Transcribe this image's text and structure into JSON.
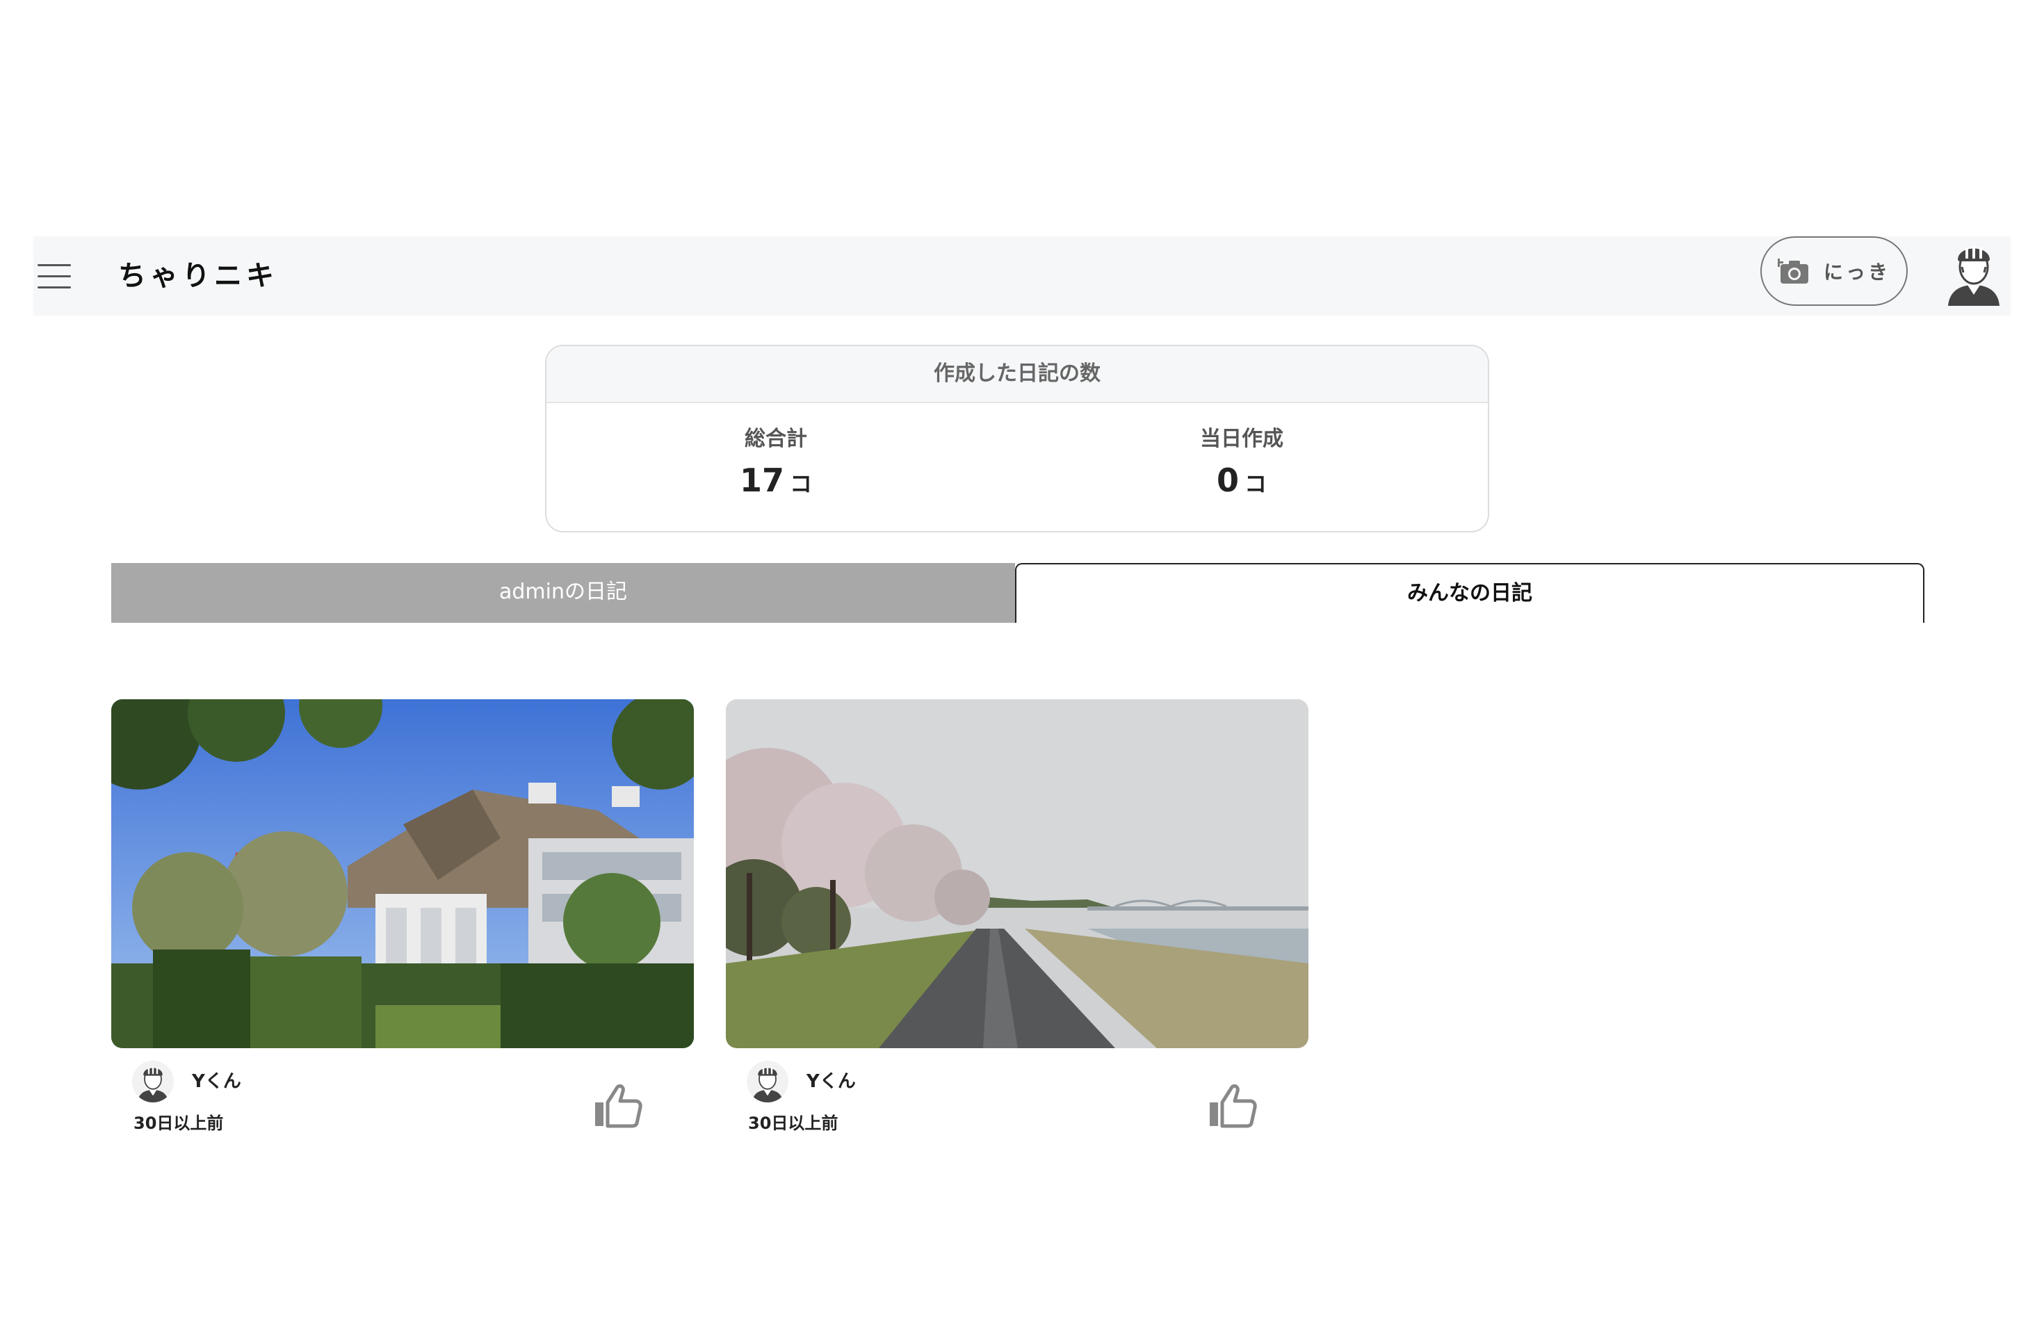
{
  "header": {
    "logo": "ちゃりニキ",
    "diary_button_label": "にっき",
    "menu_icon": "hamburger-menu-icon",
    "camera_icon": "camera-add-icon",
    "avatar_icon": "cyclist-helmet-avatar-icon"
  },
  "stats": {
    "title": "作成した日記の数",
    "total": {
      "label": "総合計",
      "value": "17",
      "unit": "コ"
    },
    "today": {
      "label": "当日作成",
      "value": "0",
      "unit": "コ"
    }
  },
  "tabs": [
    {
      "label": "adminの日記",
      "active": false
    },
    {
      "label": "みんなの日記",
      "active": true
    }
  ],
  "posts": [
    {
      "photo": "building-with-trees-blue-sky",
      "username": "Yくん",
      "time": "30日以上前",
      "like_icon": "thumbs-up-icon"
    },
    {
      "photo": "riverside-path-cherry-blossoms",
      "username": "Yくん",
      "time": "30日以上前",
      "like_icon": "thumbs-up-icon"
    }
  ],
  "colors": {
    "header_bg": "#f6f7f8",
    "tab_inactive_bg": "#a8a8a8",
    "tab_active_border": "#222222",
    "icon_gray": "#777777"
  }
}
